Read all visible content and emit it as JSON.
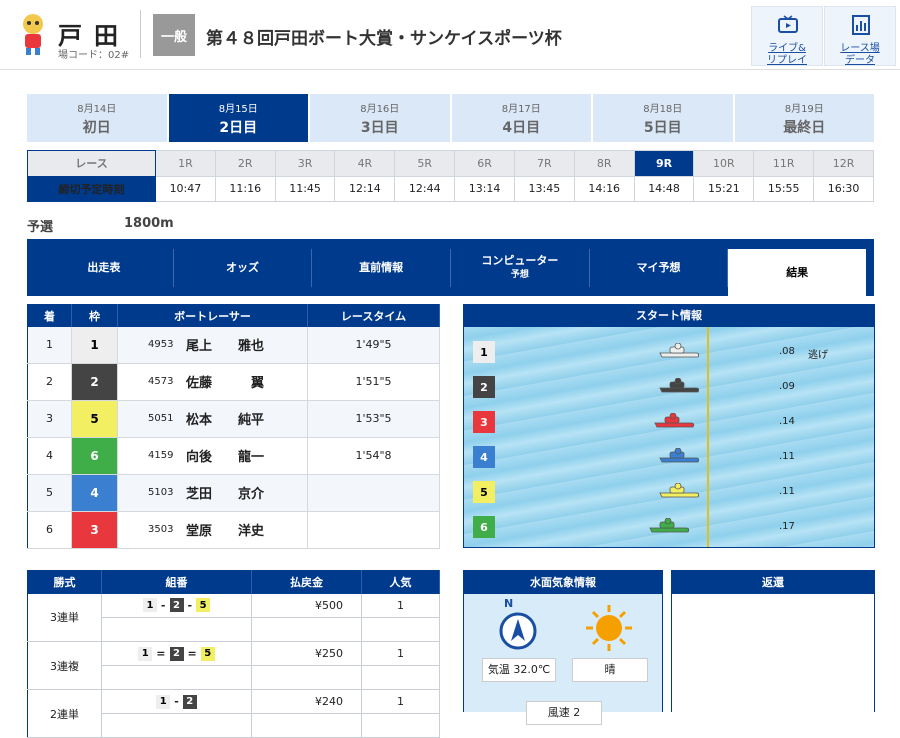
{
  "header": {
    "venue": "戸田",
    "venue_code": "場コード：02#",
    "grade": "一般",
    "race_title": "第４８回戸田ボート大賞・サンケイスポーツ杯",
    "buttons": [
      {
        "line1": "ライブ&",
        "line2": "リプレイ",
        "icon": "tv-icon"
      },
      {
        "line1": "レース場",
        "line2": "データ",
        "icon": "chart-icon"
      }
    ]
  },
  "days": [
    {
      "date": "8月14日",
      "label": "初日",
      "active": false
    },
    {
      "date": "8月15日",
      "label": "2日目",
      "active": true
    },
    {
      "date": "8月16日",
      "label": "3日目",
      "active": false
    },
    {
      "date": "8月17日",
      "label": "4日目",
      "active": false
    },
    {
      "date": "8月18日",
      "label": "5日目",
      "active": false
    },
    {
      "date": "8月19日",
      "label": "最終日",
      "active": false
    }
  ],
  "race_table": {
    "race_header": "レース",
    "time_header": "締切予定時刻",
    "races": [
      "1R",
      "2R",
      "3R",
      "4R",
      "5R",
      "6R",
      "7R",
      "8R",
      "9R",
      "10R",
      "11R",
      "12R"
    ],
    "times": [
      "10:47",
      "11:16",
      "11:45",
      "12:14",
      "12:44",
      "13:14",
      "13:45",
      "14:16",
      "14:48",
      "15:21",
      "15:55",
      "16:30"
    ],
    "selected": "9R"
  },
  "race_info": {
    "type": "予選",
    "distance": "1800m"
  },
  "tabs": [
    {
      "label": "出走表",
      "sub": ""
    },
    {
      "label": "オッズ",
      "sub": ""
    },
    {
      "label": "直前情報",
      "sub": ""
    },
    {
      "label": "コンピューター",
      "sub": "予想"
    },
    {
      "label": "マイ予想",
      "sub": ""
    },
    {
      "label": "結果",
      "sub": "",
      "active": true
    }
  ],
  "results": {
    "headers": [
      "着",
      "枠",
      "ボートレーサー",
      "レースタイム"
    ],
    "rows": [
      {
        "place": "1",
        "lane": "1",
        "id": "4953",
        "name": "尾上　　雅也",
        "time": "1'49\"5"
      },
      {
        "place": "2",
        "lane": "2",
        "id": "4573",
        "name": "佐藤　　　翼",
        "time": "1'51\"5"
      },
      {
        "place": "3",
        "lane": "5",
        "id": "5051",
        "name": "松本　　純平",
        "time": "1'53\"5"
      },
      {
        "place": "4",
        "lane": "6",
        "id": "4159",
        "name": "向後　　龍一",
        "time": "1'54\"8"
      },
      {
        "place": "5",
        "lane": "4",
        "id": "5103",
        "name": "芝田　　京介",
        "time": ""
      },
      {
        "place": "6",
        "lane": "3",
        "id": "3503",
        "name": "堂原　　洋史",
        "time": ""
      }
    ]
  },
  "start_info": {
    "title": "スタート情報",
    "rows": [
      {
        "lane": "1",
        "st": ".08",
        "note": "逃げ"
      },
      {
        "lane": "2",
        "st": ".09",
        "note": ""
      },
      {
        "lane": "3",
        "st": ".14",
        "note": ""
      },
      {
        "lane": "4",
        "st": ".11",
        "note": ""
      },
      {
        "lane": "5",
        "st": ".11",
        "note": ""
      },
      {
        "lane": "6",
        "st": ".17",
        "note": ""
      }
    ]
  },
  "payout": {
    "headers": [
      "勝式",
      "組番",
      "払戻金",
      "人気"
    ],
    "rows": [
      {
        "type": "3連単",
        "combo": [
          "1",
          "-",
          "2",
          "-",
          "5"
        ],
        "amount": "¥500",
        "pop": "1"
      },
      {
        "type": "3連複",
        "combo": [
          "1",
          "=",
          "2",
          "=",
          "5"
        ],
        "amount": "¥250",
        "pop": "1"
      },
      {
        "type": "2連単",
        "combo": [
          "1",
          "-",
          "2"
        ],
        "amount": "¥240",
        "pop": "1"
      }
    ]
  },
  "weather": {
    "title": "水面気象情報",
    "compass_label": "N",
    "temp_label": "気温 32.0℃",
    "condition": "晴",
    "wind_label": "風速 2"
  },
  "refund": {
    "title": "返還"
  },
  "lane_colors": {
    "1": "#eeeeee",
    "2": "#444444",
    "3": "#e8383d",
    "4": "#3b7fd0",
    "5": "#f3ef63",
    "6": "#3fae49"
  },
  "lane_text": {
    "1": "#000",
    "2": "#fff",
    "3": "#fff",
    "4": "#fff",
    "5": "#000",
    "6": "#fff"
  }
}
